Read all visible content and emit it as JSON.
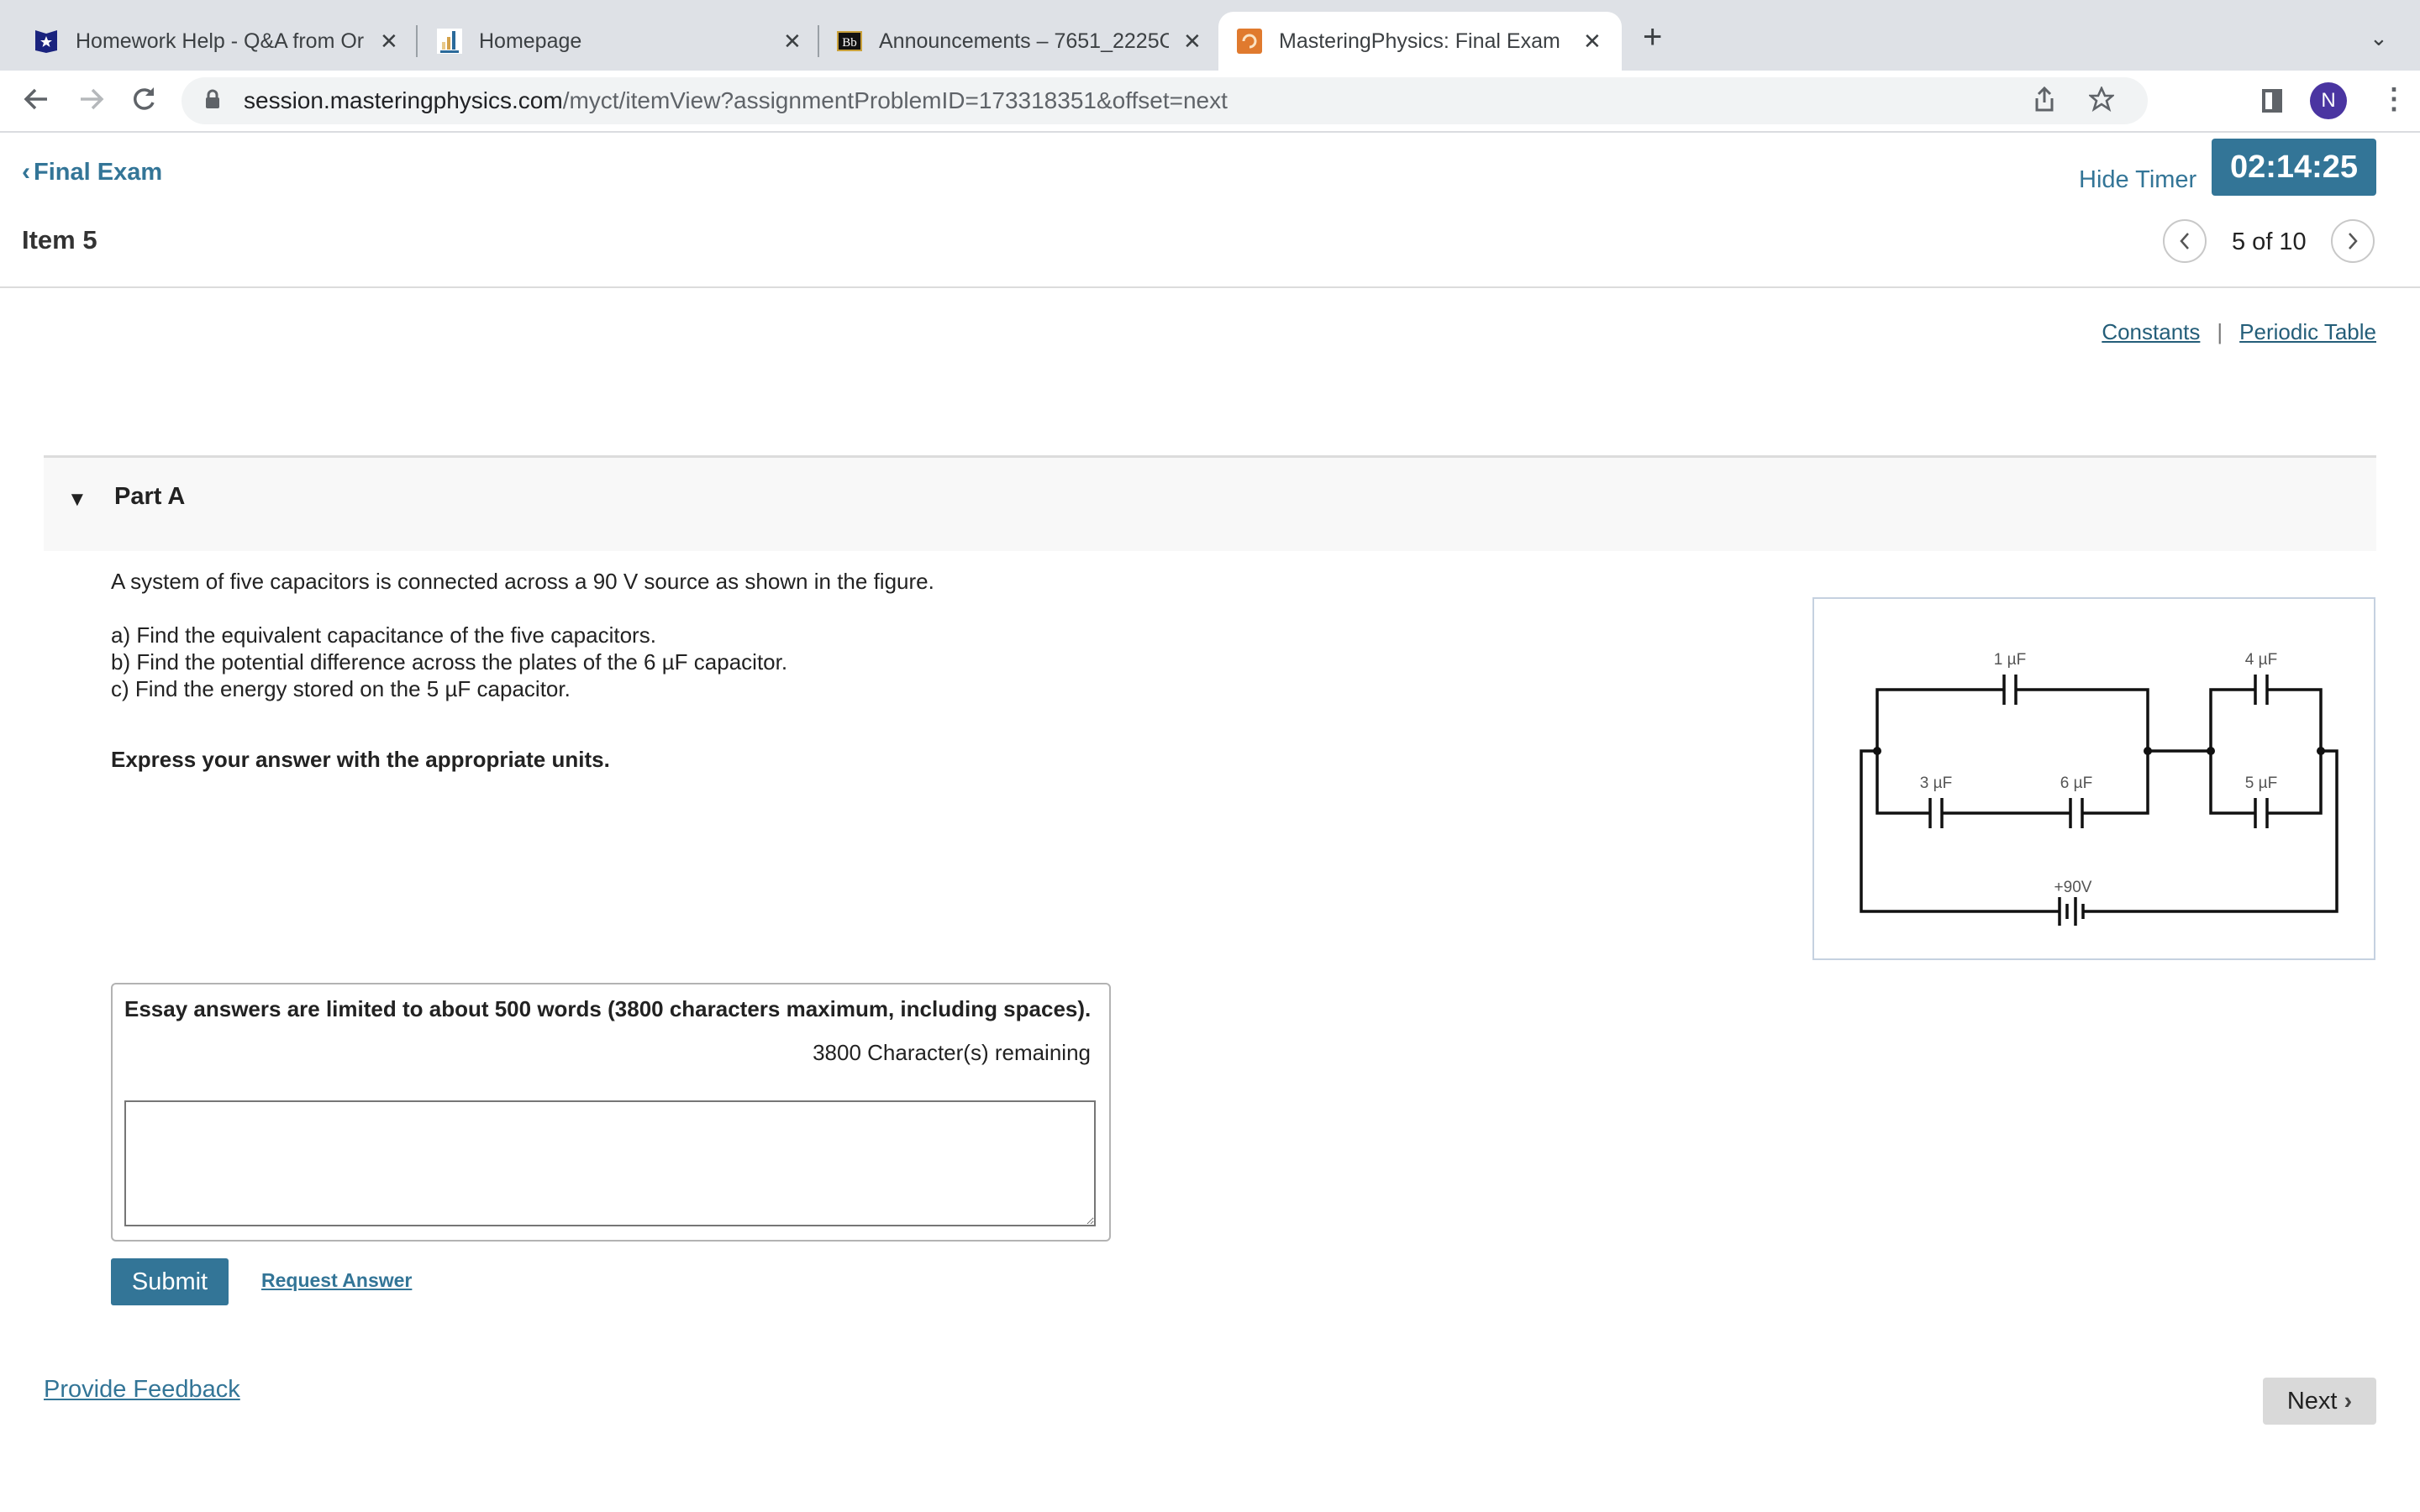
{
  "browser": {
    "tabs": [
      {
        "title": "Homework Help - Q&A from Or",
        "favicon": "star-shield-icon",
        "active": false
      },
      {
        "title": "Homepage",
        "favicon": "bar-chart-icon",
        "active": false
      },
      {
        "title": "Announcements – 7651_2225C",
        "favicon": "blackboard-icon",
        "active": false
      },
      {
        "title": "MasteringPhysics: Final Exam",
        "favicon": "mastering-icon",
        "active": true
      }
    ],
    "close_glyph": "✕",
    "new_tab_glyph": "+",
    "tab_search_glyph": "⌄",
    "url_host": "session.masteringphysics.com",
    "url_path": "/myct/itemView?assignmentProblemID=173318351&offset=next",
    "profile_initial": "N",
    "profile_color": "#4a35a1"
  },
  "header": {
    "back_label": "Final Exam",
    "item_title": "Item 5",
    "hide_timer_label": "Hide Timer",
    "timer": "02:14:25",
    "pager": "5 of 10",
    "accent_color": "#337597"
  },
  "links": {
    "constants": "Constants",
    "separator": "|",
    "periodic_table": "Periodic Table"
  },
  "part": {
    "title": "Part A",
    "intro": "A system of five capacitors is connected across a 90 V source as shown in the figure.",
    "questions": [
      "a) Find the equivalent capacitance of the five capacitors.",
      "b) Find the potential difference across the plates of the 6 µF capacitor.",
      "c) Find the energy stored on the 5 µF capacitor."
    ],
    "instruction": "Express your answer with the appropriate units."
  },
  "figure": {
    "capacitors": [
      {
        "id": "c1",
        "label": "1 µF"
      },
      {
        "id": "c3",
        "label": "3 µF"
      },
      {
        "id": "c6",
        "label": "6 µF"
      },
      {
        "id": "c4",
        "label": "4 µF"
      },
      {
        "id": "c5",
        "label": "5 µF"
      }
    ],
    "source_label": "+90V"
  },
  "essay": {
    "limit_text": "Essay answers are limited to about 500 words (3800 characters maximum, including spaces).",
    "remaining_text": "3800 Character(s) remaining",
    "value": ""
  },
  "actions": {
    "submit": "Submit",
    "request_answer": "Request Answer",
    "provide_feedback": "Provide Feedback",
    "next": "Next"
  }
}
